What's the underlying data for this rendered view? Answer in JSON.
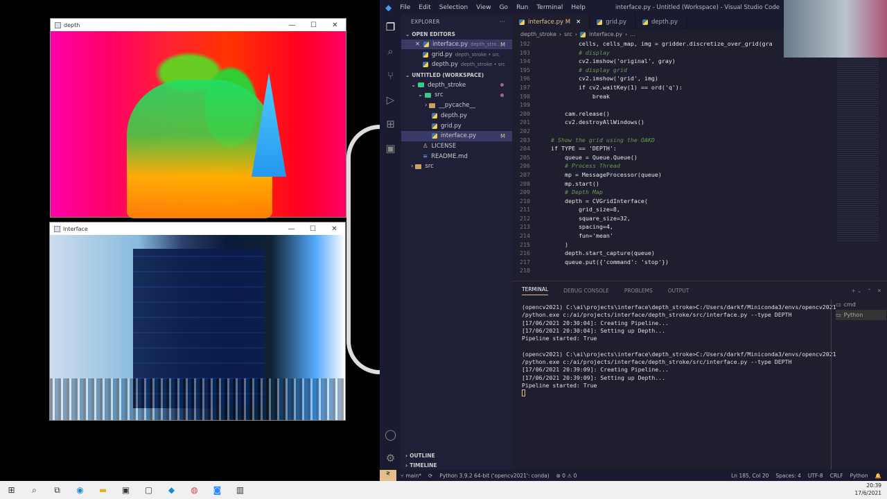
{
  "windows": {
    "depth": {
      "title": "depth",
      "btn_min": "—",
      "btn_max": "☐",
      "btn_close": "✕"
    },
    "interface": {
      "title": "Interface",
      "btn_min": "—",
      "btn_max": "☐",
      "btn_close": "✕"
    }
  },
  "vscode": {
    "menu": [
      "File",
      "Edit",
      "Selection",
      "View",
      "Go",
      "Run",
      "Terminal",
      "Help"
    ],
    "window_title": "interface.py - Untitled (Workspace) - Visual Studio Code",
    "sidebar": {
      "explorer_label": "EXPLORER",
      "open_editors_label": "OPEN EDITORS",
      "open_editors": [
        {
          "name": "interface.py",
          "path": "depth_stro...",
          "badge": "M"
        },
        {
          "name": "grid.py",
          "path": "depth_stroke • src",
          "badge": ""
        },
        {
          "name": "depth.py",
          "path": "depth_stroke • src",
          "badge": ""
        }
      ],
      "workspace_label": "UNTITLED (WORKSPACE)",
      "tree": [
        {
          "name": "depth_stroke"
        },
        {
          "name": "src"
        },
        {
          "name": "__pycache__"
        },
        {
          "name": "depth.py"
        },
        {
          "name": "grid.py"
        },
        {
          "name": "interface.py",
          "badge": "M"
        },
        {
          "name": "LICENSE"
        },
        {
          "name": "README.md"
        },
        {
          "name": "src"
        }
      ],
      "outline_label": "OUTLINE",
      "timeline_label": "TIMELINE"
    },
    "tabs": [
      {
        "label": "interface.py M"
      },
      {
        "label": "grid.py"
      },
      {
        "label": "depth.py"
      }
    ],
    "breadcrumb": [
      "depth_stroke",
      "src",
      "interface.py",
      "..."
    ],
    "code_lines": [
      {
        "n": "192",
        "t": "            cells, cells_map, img = gridder.discretize_over_grid(gra"
      },
      {
        "n": "193",
        "t": "            # display"
      },
      {
        "n": "194",
        "t": "            cv2.imshow('original', gray)"
      },
      {
        "n": "195",
        "t": "            # display grid"
      },
      {
        "n": "196",
        "t": "            cv2.imshow('grid', img)"
      },
      {
        "n": "197",
        "t": "            if cv2.waitKey(1) == ord('q'):"
      },
      {
        "n": "198",
        "t": "                break"
      },
      {
        "n": "199",
        "t": ""
      },
      {
        "n": "200",
        "t": "        cam.release()"
      },
      {
        "n": "201",
        "t": "        cv2.destroyAllWindows()"
      },
      {
        "n": "202",
        "t": ""
      },
      {
        "n": "203",
        "t": "    # Show the grid using the OAKD"
      },
      {
        "n": "204",
        "t": "    if TYPE == 'DEPTH':"
      },
      {
        "n": "205",
        "t": "        queue = Queue.Queue()"
      },
      {
        "n": "206",
        "t": "        # Process Thread"
      },
      {
        "n": "207",
        "t": "        mp = MessageProcessor(queue)"
      },
      {
        "n": "208",
        "t": "        mp.start()"
      },
      {
        "n": "209",
        "t": "        # Depth Map"
      },
      {
        "n": "210",
        "t": "        depth = CVGridInterface("
      },
      {
        "n": "211",
        "t": "            grid_size=8,"
      },
      {
        "n": "212",
        "t": "            square_size=32,"
      },
      {
        "n": "213",
        "t": "            spacing=4,"
      },
      {
        "n": "214",
        "t": "            fun='mean'"
      },
      {
        "n": "215",
        "t": "        )"
      },
      {
        "n": "216",
        "t": "        depth.start_capture(queue)"
      },
      {
        "n": "217",
        "t": "        queue.put({'command': 'stop'})"
      },
      {
        "n": "218",
        "t": ""
      }
    ],
    "panel": {
      "tabs": [
        "TERMINAL",
        "DEBUG CONSOLE",
        "PROBLEMS",
        "OUTPUT"
      ],
      "terminal_lines": [
        "(opencv2021) C:\\ai\\projects\\interface\\depth_stroke>C:/Users/darkf/Miniconda3/envs/opencv2021",
        "/python.exe c:/ai/projects/interface/depth_stroke/src/interface.py --type DEPTH",
        "[17/06/2021 20:30:04]: Creating Pipeline...",
        "[17/06/2021 20:30:04]: Setting up Depth...",
        "Pipeline started: True",
        "",
        "(opencv2021) C:\\ai\\projects\\interface\\depth_stroke>C:/Users/darkf/Miniconda3/envs/opencv2021",
        "/python.exe c:/ai/projects/interface/depth_stroke/src/interface.py --type DEPTH",
        "[17/06/2021 20:39:09]: Creating Pipeline...",
        "[17/06/2021 20:39:09]: Setting up Depth...",
        "Pipeline started: True"
      ],
      "terminal_list": [
        "cmd",
        "Python"
      ]
    },
    "status": {
      "branch": "main*",
      "interpreter": "Python 3.9.2 64-bit ('opencv2021': conda)",
      "problems": "⊗ 0  ⚠ 0",
      "position": "Ln 185, Col 20",
      "spaces": "Spaces: 4",
      "encoding": "UTF-8",
      "eol": "CRLF",
      "language": "Python"
    }
  },
  "taskbar": {
    "time": "20:39",
    "date": "17/6/2021"
  }
}
